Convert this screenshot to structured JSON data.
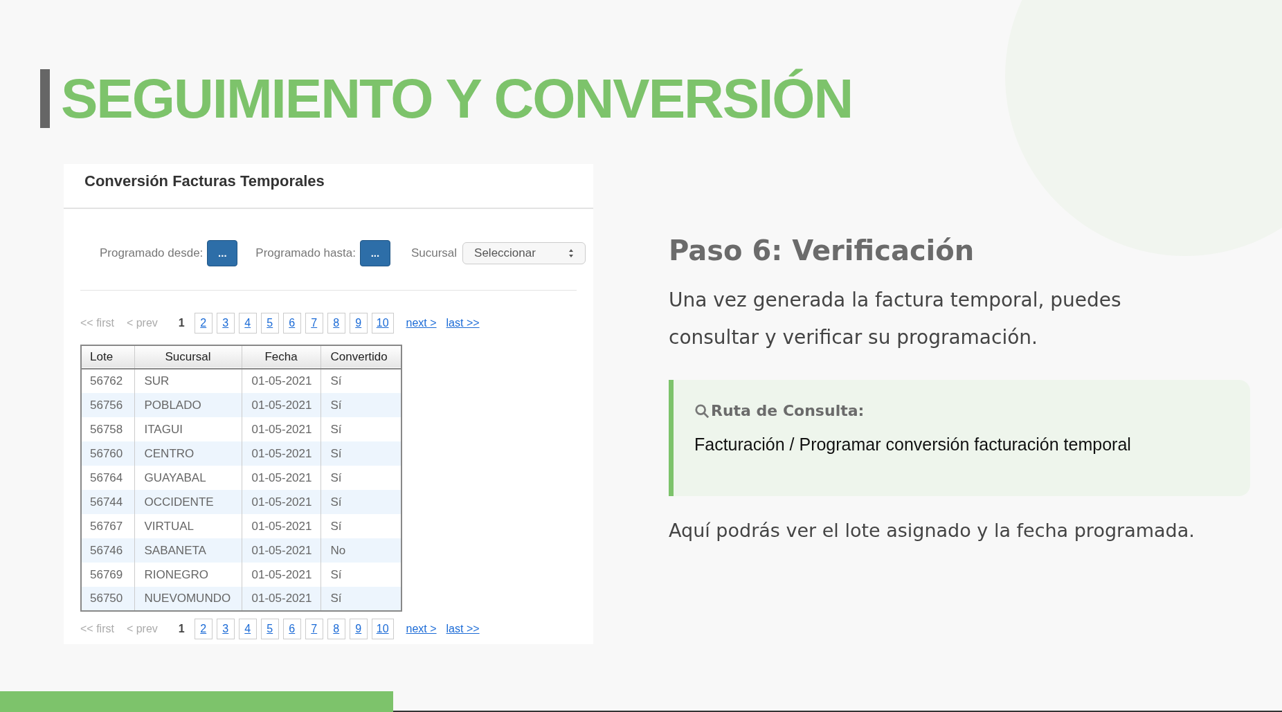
{
  "slide_title": "SEGUIMIENTO Y CONVERSIÓN",
  "app": {
    "title": "Conversión Facturas Temporales",
    "filters": [
      {
        "kind": "date",
        "label": "Programado desde:",
        "button": "..."
      },
      {
        "kind": "date",
        "label": "Programado hasta:",
        "button": "..."
      },
      {
        "kind": "select",
        "label": "Sucursal",
        "value": "Seleccionar"
      }
    ],
    "pagination_top": {
      "first": "<< first",
      "prev": "< prev",
      "pages": [
        {
          "label": "1",
          "selected": true
        },
        {
          "label": "2",
          "selected": false
        },
        {
          "label": "3",
          "selected": false
        },
        {
          "label": "4",
          "selected": false
        },
        {
          "label": "5",
          "selected": false
        },
        {
          "label": "6",
          "selected": false
        },
        {
          "label": "7",
          "selected": false
        },
        {
          "label": "8",
          "selected": false
        },
        {
          "label": "9",
          "selected": false
        },
        {
          "label": "10",
          "selected": false
        }
      ],
      "next": "next >",
      "last": "last >>"
    },
    "table": {
      "columns": [
        "Lote",
        "Sucursal",
        "Fecha",
        "Convertido"
      ],
      "rows": [
        [
          "56762",
          "SUR",
          "01-05-2021",
          "Sí"
        ],
        [
          "56756",
          "POBLADO",
          "01-05-2021",
          "Sí"
        ],
        [
          "56758",
          "ITAGUI",
          "01-05-2021",
          "Sí"
        ],
        [
          "56760",
          "CENTRO",
          "01-05-2021",
          "Sí"
        ],
        [
          "56764",
          "GUAYABAL",
          "01-05-2021",
          "Sí"
        ],
        [
          "56744",
          "OCCIDENTE",
          "01-05-2021",
          "Sí"
        ],
        [
          "56767",
          "VIRTUAL",
          "01-05-2021",
          "Sí"
        ],
        [
          "56746",
          "SABANETA",
          "01-05-2021",
          "No"
        ],
        [
          "56769",
          "RIONEGRO",
          "01-05-2021",
          "Sí"
        ],
        [
          "56750",
          "NUEVOMUNDO",
          "01-05-2021",
          "Sí"
        ]
      ]
    },
    "pagination_bottom": {
      "first": "<< first",
      "prev": "< prev",
      "pages": [
        {
          "label": "1",
          "selected": true
        },
        {
          "label": "2",
          "selected": false
        },
        {
          "label": "3",
          "selected": false
        },
        {
          "label": "4",
          "selected": false
        },
        {
          "label": "5",
          "selected": false
        },
        {
          "label": "6",
          "selected": false
        },
        {
          "label": "7",
          "selected": false
        },
        {
          "label": "8",
          "selected": false
        },
        {
          "label": "9",
          "selected": false
        },
        {
          "label": "10",
          "selected": false
        }
      ],
      "next": "next >",
      "last": "last >>"
    }
  },
  "step": {
    "heading": "Paso 6: Verificación",
    "intro": "Una vez generada la factura temporal, puedes consultar y verificar su programación.",
    "callout": {
      "title": "Ruta de Consulta:",
      "path": "Facturación / Programar conversión facturación temporal"
    },
    "outro": "Aquí podrás ver el lote asignado y la fecha programada."
  }
}
